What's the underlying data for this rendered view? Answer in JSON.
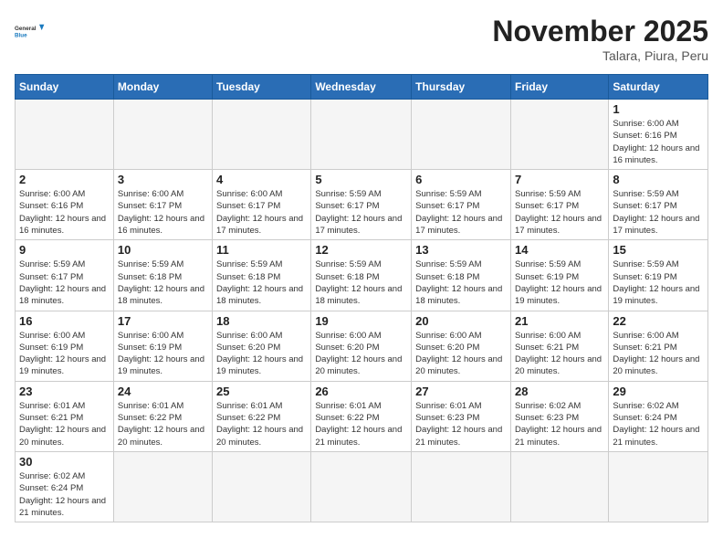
{
  "header": {
    "logo_general": "General",
    "logo_blue": "Blue",
    "month_title": "November 2025",
    "location": "Talara, Piura, Peru"
  },
  "days_of_week": [
    "Sunday",
    "Monday",
    "Tuesday",
    "Wednesday",
    "Thursday",
    "Friday",
    "Saturday"
  ],
  "weeks": [
    [
      {
        "day": "",
        "info": ""
      },
      {
        "day": "",
        "info": ""
      },
      {
        "day": "",
        "info": ""
      },
      {
        "day": "",
        "info": ""
      },
      {
        "day": "",
        "info": ""
      },
      {
        "day": "",
        "info": ""
      },
      {
        "day": "1",
        "info": "Sunrise: 6:00 AM\nSunset: 6:16 PM\nDaylight: 12 hours and 16 minutes."
      }
    ],
    [
      {
        "day": "2",
        "info": "Sunrise: 6:00 AM\nSunset: 6:16 PM\nDaylight: 12 hours and 16 minutes."
      },
      {
        "day": "3",
        "info": "Sunrise: 6:00 AM\nSunset: 6:17 PM\nDaylight: 12 hours and 16 minutes."
      },
      {
        "day": "4",
        "info": "Sunrise: 6:00 AM\nSunset: 6:17 PM\nDaylight: 12 hours and 17 minutes."
      },
      {
        "day": "5",
        "info": "Sunrise: 5:59 AM\nSunset: 6:17 PM\nDaylight: 12 hours and 17 minutes."
      },
      {
        "day": "6",
        "info": "Sunrise: 5:59 AM\nSunset: 6:17 PM\nDaylight: 12 hours and 17 minutes."
      },
      {
        "day": "7",
        "info": "Sunrise: 5:59 AM\nSunset: 6:17 PM\nDaylight: 12 hours and 17 minutes."
      },
      {
        "day": "8",
        "info": "Sunrise: 5:59 AM\nSunset: 6:17 PM\nDaylight: 12 hours and 17 minutes."
      }
    ],
    [
      {
        "day": "9",
        "info": "Sunrise: 5:59 AM\nSunset: 6:17 PM\nDaylight: 12 hours and 18 minutes."
      },
      {
        "day": "10",
        "info": "Sunrise: 5:59 AM\nSunset: 6:18 PM\nDaylight: 12 hours and 18 minutes."
      },
      {
        "day": "11",
        "info": "Sunrise: 5:59 AM\nSunset: 6:18 PM\nDaylight: 12 hours and 18 minutes."
      },
      {
        "day": "12",
        "info": "Sunrise: 5:59 AM\nSunset: 6:18 PM\nDaylight: 12 hours and 18 minutes."
      },
      {
        "day": "13",
        "info": "Sunrise: 5:59 AM\nSunset: 6:18 PM\nDaylight: 12 hours and 18 minutes."
      },
      {
        "day": "14",
        "info": "Sunrise: 5:59 AM\nSunset: 6:19 PM\nDaylight: 12 hours and 19 minutes."
      },
      {
        "day": "15",
        "info": "Sunrise: 5:59 AM\nSunset: 6:19 PM\nDaylight: 12 hours and 19 minutes."
      }
    ],
    [
      {
        "day": "16",
        "info": "Sunrise: 6:00 AM\nSunset: 6:19 PM\nDaylight: 12 hours and 19 minutes."
      },
      {
        "day": "17",
        "info": "Sunrise: 6:00 AM\nSunset: 6:19 PM\nDaylight: 12 hours and 19 minutes."
      },
      {
        "day": "18",
        "info": "Sunrise: 6:00 AM\nSunset: 6:20 PM\nDaylight: 12 hours and 19 minutes."
      },
      {
        "day": "19",
        "info": "Sunrise: 6:00 AM\nSunset: 6:20 PM\nDaylight: 12 hours and 20 minutes."
      },
      {
        "day": "20",
        "info": "Sunrise: 6:00 AM\nSunset: 6:20 PM\nDaylight: 12 hours and 20 minutes."
      },
      {
        "day": "21",
        "info": "Sunrise: 6:00 AM\nSunset: 6:21 PM\nDaylight: 12 hours and 20 minutes."
      },
      {
        "day": "22",
        "info": "Sunrise: 6:00 AM\nSunset: 6:21 PM\nDaylight: 12 hours and 20 minutes."
      }
    ],
    [
      {
        "day": "23",
        "info": "Sunrise: 6:01 AM\nSunset: 6:21 PM\nDaylight: 12 hours and 20 minutes."
      },
      {
        "day": "24",
        "info": "Sunrise: 6:01 AM\nSunset: 6:22 PM\nDaylight: 12 hours and 20 minutes."
      },
      {
        "day": "25",
        "info": "Sunrise: 6:01 AM\nSunset: 6:22 PM\nDaylight: 12 hours and 20 minutes."
      },
      {
        "day": "26",
        "info": "Sunrise: 6:01 AM\nSunset: 6:22 PM\nDaylight: 12 hours and 21 minutes."
      },
      {
        "day": "27",
        "info": "Sunrise: 6:01 AM\nSunset: 6:23 PM\nDaylight: 12 hours and 21 minutes."
      },
      {
        "day": "28",
        "info": "Sunrise: 6:02 AM\nSunset: 6:23 PM\nDaylight: 12 hours and 21 minutes."
      },
      {
        "day": "29",
        "info": "Sunrise: 6:02 AM\nSunset: 6:24 PM\nDaylight: 12 hours and 21 minutes."
      }
    ],
    [
      {
        "day": "30",
        "info": "Sunrise: 6:02 AM\nSunset: 6:24 PM\nDaylight: 12 hours and 21 minutes."
      },
      {
        "day": "",
        "info": ""
      },
      {
        "day": "",
        "info": ""
      },
      {
        "day": "",
        "info": ""
      },
      {
        "day": "",
        "info": ""
      },
      {
        "day": "",
        "info": ""
      },
      {
        "day": "",
        "info": ""
      }
    ]
  ]
}
